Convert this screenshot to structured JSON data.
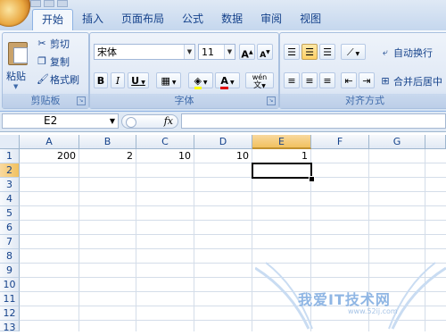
{
  "ribbon": {
    "tabs": [
      {
        "label": "开始",
        "active": true
      },
      {
        "label": "插入",
        "active": false
      },
      {
        "label": "页面布局",
        "active": false
      },
      {
        "label": "公式",
        "active": false
      },
      {
        "label": "数据",
        "active": false
      },
      {
        "label": "审阅",
        "active": false
      },
      {
        "label": "视图",
        "active": false
      }
    ],
    "clipboard": {
      "group_label": "剪贴板",
      "paste_label": "粘贴",
      "cut_label": "剪切",
      "copy_label": "复制",
      "format_painter_label": "格式刷"
    },
    "font": {
      "group_label": "字体",
      "font_name": "宋体",
      "font_size": "11",
      "grow_label": "A",
      "shrink_label": "A",
      "bold_label": "B",
      "italic_label": "I",
      "underline_label": "U",
      "phonetic_label": "wén",
      "font_color_label": "A"
    },
    "alignment": {
      "group_label": "对齐方式",
      "wrap_text_label": "自动换行",
      "merge_center_label": "合并后居中"
    }
  },
  "formula_bar": {
    "name_box": "E2",
    "fx_label": "fx",
    "formula": ""
  },
  "sheet": {
    "columns": [
      "A",
      "B",
      "C",
      "D",
      "E",
      "F",
      "G"
    ],
    "selected_column": "E",
    "rows": [
      "1",
      "2",
      "3",
      "4",
      "5",
      "6",
      "7",
      "8",
      "9",
      "10",
      "11",
      "12",
      "13"
    ],
    "selected_row": "2",
    "row1": [
      "200",
      "2",
      "10",
      "10",
      "1",
      "",
      ""
    ]
  },
  "watermark": {
    "text": "我爱IT技术网",
    "url": "www.52ij.com"
  },
  "colors": {
    "ribbon_bg": "#dfe9f5",
    "header_selected": "#f1c15f",
    "text_blue": "#15428b"
  }
}
